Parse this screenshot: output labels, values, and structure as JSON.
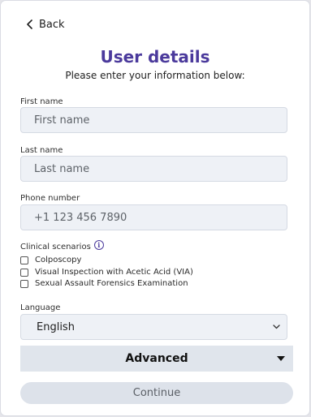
{
  "nav": {
    "back_label": "Back"
  },
  "header": {
    "title": "User details",
    "subtitle": "Please enter your information below:"
  },
  "form": {
    "first_name": {
      "label": "First name",
      "placeholder": "First name",
      "value": ""
    },
    "last_name": {
      "label": "Last name",
      "placeholder": "Last name",
      "value": ""
    },
    "phone": {
      "label": "Phone number",
      "placeholder": "+1 123 456 7890",
      "value": ""
    },
    "scenarios": {
      "label": "Clinical scenarios",
      "info_icon": "info-icon",
      "options": [
        {
          "label": "Colposcopy",
          "checked": false
        },
        {
          "label": "Visual Inspection with Acetic Acid (VIA)",
          "checked": false
        },
        {
          "label": "Sexual Assault Forensics Examination",
          "checked": false
        }
      ]
    },
    "language": {
      "label": "Language",
      "selected": "English"
    },
    "advanced": {
      "label": "Advanced"
    },
    "continue_label": "Continue"
  },
  "colors": {
    "title": "#4b3a9c",
    "input_bg": "#eef1f6",
    "advanced_bg": "#e0e5ec",
    "button_bg": "#dde2ea"
  }
}
